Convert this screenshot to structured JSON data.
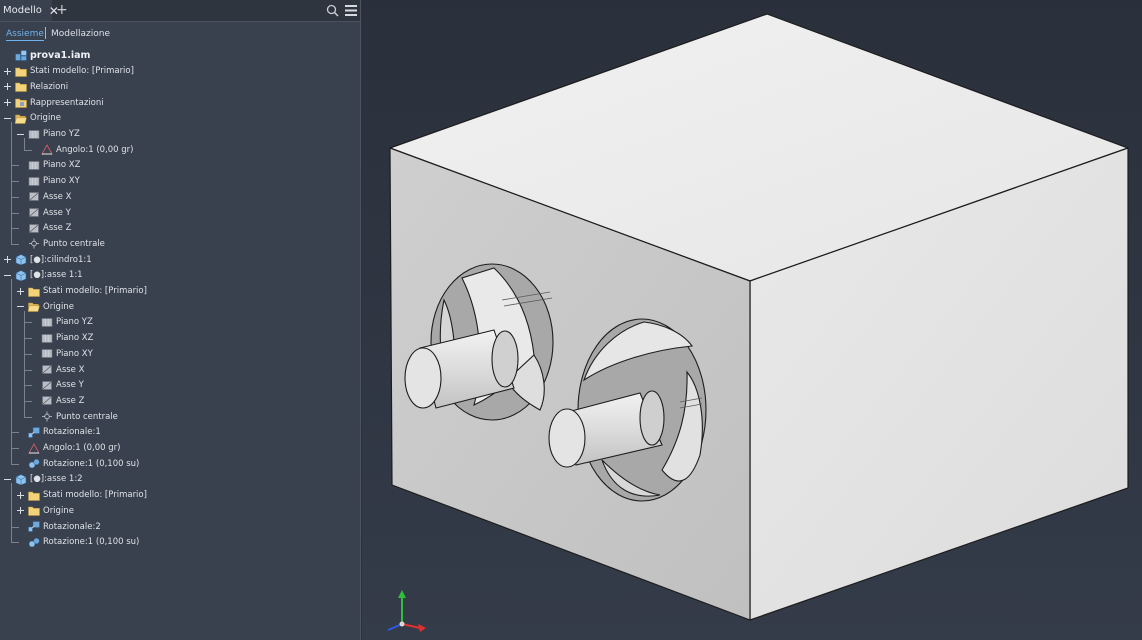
{
  "tab": {
    "title": "Modello"
  },
  "subtabs": {
    "assieme": "Assieme",
    "modellazione": "Modellazione"
  },
  "tree": [
    {
      "label": "prova1.iam",
      "icon": "assembly",
      "level": 0,
      "toggle": "none",
      "bold": true
    },
    {
      "label": "Stati modello: [Primario]",
      "icon": "folder",
      "level": 0,
      "toggle": "plus"
    },
    {
      "label": "Relazioni",
      "icon": "folder",
      "level": 0,
      "toggle": "plus"
    },
    {
      "label": "Rappresentazioni",
      "icon": "folder-views",
      "level": 0,
      "toggle": "plus"
    },
    {
      "label": "Origine",
      "icon": "folder-open",
      "level": 0,
      "toggle": "minus"
    },
    {
      "label": "Piano YZ",
      "icon": "plane",
      "level": 1,
      "toggle": "minus"
    },
    {
      "label": "Angolo:1 (0,00 gr)",
      "icon": "angle",
      "level": 2,
      "toggle": "none"
    },
    {
      "label": "Piano XZ",
      "icon": "plane",
      "level": 1,
      "toggle": "none"
    },
    {
      "label": "Piano XY",
      "icon": "plane",
      "level": 1,
      "toggle": "none"
    },
    {
      "label": "Asse X",
      "icon": "axis",
      "level": 1,
      "toggle": "none"
    },
    {
      "label": "Asse Y",
      "icon": "axis",
      "level": 1,
      "toggle": "none"
    },
    {
      "label": "Asse Z",
      "icon": "axis",
      "level": 1,
      "toggle": "none"
    },
    {
      "label": "Punto centrale",
      "icon": "point",
      "level": 1,
      "toggle": "none"
    },
    {
      "label": "[●]:cilindro1:1",
      "icon": "part",
      "level": 0,
      "toggle": "plus"
    },
    {
      "label": "[●]:asse 1:1",
      "icon": "part",
      "level": 0,
      "toggle": "minus"
    },
    {
      "label": "Stati modello: [Primario]",
      "icon": "folder",
      "level": 1,
      "toggle": "plus"
    },
    {
      "label": "Origine",
      "icon": "folder-open",
      "level": 1,
      "toggle": "minus"
    },
    {
      "label": "Piano YZ",
      "icon": "plane",
      "level": 2,
      "toggle": "none"
    },
    {
      "label": "Piano XZ",
      "icon": "plane",
      "level": 2,
      "toggle": "none"
    },
    {
      "label": "Piano XY",
      "icon": "plane",
      "level": 2,
      "toggle": "none"
    },
    {
      "label": "Asse X",
      "icon": "axis",
      "level": 2,
      "toggle": "none"
    },
    {
      "label": "Asse Y",
      "icon": "axis",
      "level": 2,
      "toggle": "none"
    },
    {
      "label": "Asse Z",
      "icon": "axis",
      "level": 2,
      "toggle": "none"
    },
    {
      "label": "Punto centrale",
      "icon": "point",
      "level": 2,
      "toggle": "none"
    },
    {
      "label": "Rotazionale:1",
      "icon": "revolute",
      "level": 1,
      "toggle": "none"
    },
    {
      "label": "Angolo:1 (0,00 gr)",
      "icon": "angle",
      "level": 1,
      "toggle": "none"
    },
    {
      "label": "Rotazione:1 (0,100 su)",
      "icon": "rotation",
      "level": 1,
      "toggle": "none"
    },
    {
      "label": "[●]:asse 1:2",
      "icon": "part",
      "level": 0,
      "toggle": "minus"
    },
    {
      "label": "Stati modello: [Primario]",
      "icon": "folder",
      "level": 1,
      "toggle": "plus"
    },
    {
      "label": "Origine",
      "icon": "folder",
      "level": 1,
      "toggle": "plus"
    },
    {
      "label": "Rotazionale:2",
      "icon": "revolute",
      "level": 1,
      "toggle": "none"
    },
    {
      "label": "Rotazione:1 (0,100 su)",
      "icon": "rotation",
      "level": 1,
      "toggle": "none"
    }
  ],
  "colors": {
    "panel_bg": "#3a414e",
    "viewport_bg": "#2b313d",
    "accent": "#6fb3f0",
    "folder": "#f2d37a",
    "part": "#8ec3ef"
  },
  "icons": {
    "close": "close-icon",
    "add": "plus-icon",
    "search": "search-icon",
    "menu": "hamburger-menu-icon",
    "view_cube_triad": "xyz-triad-icon"
  }
}
